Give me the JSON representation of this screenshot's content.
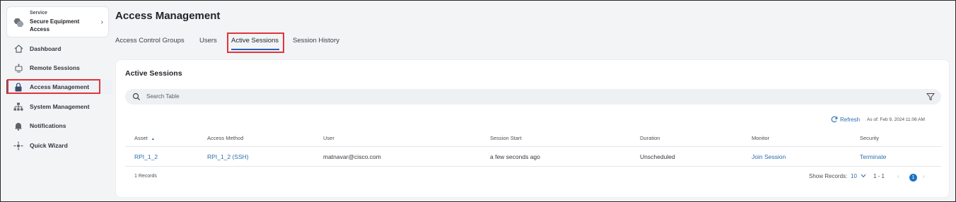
{
  "sidebar": {
    "service_kicker": "Service",
    "service_name": "Secure Equipment Access",
    "items": [
      {
        "label": "Dashboard",
        "icon": "home-icon"
      },
      {
        "label": "Remote Sessions",
        "icon": "remote-sessions-icon"
      },
      {
        "label": "Access Management",
        "icon": "lock-icon",
        "active": true
      },
      {
        "label": "System Management",
        "icon": "network-icon"
      },
      {
        "label": "Notifications",
        "icon": "bell-icon"
      },
      {
        "label": "Quick Wizard",
        "icon": "wizard-icon"
      }
    ]
  },
  "main": {
    "title": "Access Management",
    "tabs": [
      {
        "label": "Access Control Groups"
      },
      {
        "label": "Users"
      },
      {
        "label": "Active Sessions",
        "active": true
      },
      {
        "label": "Session History"
      }
    ],
    "card_title": "Active Sessions",
    "search_placeholder": "Search Table",
    "refresh_label": "Refresh",
    "as_of": "As of: Feb 9, 2024 11:06 AM",
    "table": {
      "columns": [
        "Asset",
        "Access Method",
        "User",
        "Session Start",
        "Duration",
        "Monitor",
        "Security"
      ],
      "sort_indicator": "▲",
      "rows": [
        [
          "RPI_1_2",
          "RPI_1_2 (SSH)",
          "matnavar@cisco.com",
          "a few seconds ago",
          "Unscheduled",
          "Join Session",
          "Terminate"
        ]
      ]
    },
    "records_label": "1 Records",
    "show_records_label": "Show Records:",
    "show_records_value": "10",
    "range": "1 - 1",
    "current_page": "1"
  },
  "colors": {
    "accent": "#2b6cb0",
    "highlight_box": "#e0353a",
    "tab_underline": "#2b5fb4",
    "page_dot": "#1a73c8"
  }
}
